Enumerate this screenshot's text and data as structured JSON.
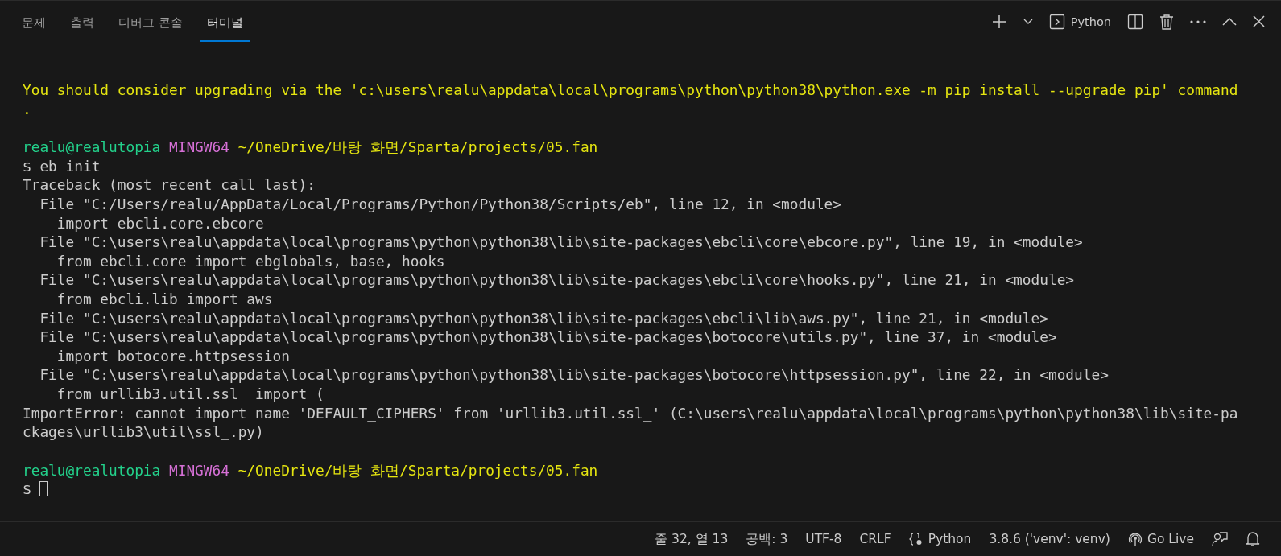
{
  "tabs": [
    {
      "label": "문제",
      "selected": false
    },
    {
      "label": "출력",
      "selected": false
    },
    {
      "label": "디버그 콘솔",
      "selected": false
    },
    {
      "label": "터미널",
      "selected": true
    }
  ],
  "toolbar": {
    "shell_label": "Python"
  },
  "terminal": {
    "blocks": [
      [
        {
          "segments": [
            {
              "kind": "warning",
              "text": "You should consider upgrading via the 'c:\\users\\realu\\appdata\\local\\programs\\python\\python38\\python.exe -m pip install --upgrade pip' command"
            }
          ]
        },
        {
          "segments": [
            {
              "kind": "warning",
              "text": "."
            }
          ]
        }
      ],
      [
        {
          "segments": [
            {
              "kind": "user",
              "text": "realu@realutopia"
            },
            {
              "kind": "host",
              "text": "MINGW64"
            },
            {
              "kind": "path",
              "text": "~/OneDrive/바탕 화면/Sparta/projects/05.fan"
            }
          ]
        },
        {
          "segments": [
            {
              "kind": "plain",
              "text": "$ eb init"
            }
          ]
        },
        {
          "segments": [
            {
              "kind": "plain",
              "text": "Traceback (most recent call last):"
            }
          ]
        },
        {
          "segments": [
            {
              "kind": "plain",
              "text": "  File \"C:/Users/realu/AppData/Local/Programs/Python/Python38/Scripts/eb\", line 12, in <module>"
            }
          ]
        },
        {
          "segments": [
            {
              "kind": "plain",
              "text": "    import ebcli.core.ebcore"
            }
          ]
        },
        {
          "segments": [
            {
              "kind": "plain",
              "text": "  File \"C:\\users\\realu\\appdata\\local\\programs\\python\\python38\\lib\\site-packages\\ebcli\\core\\ebcore.py\", line 19, in <module>"
            }
          ]
        },
        {
          "segments": [
            {
              "kind": "plain",
              "text": "    from ebcli.core import ebglobals, base, hooks"
            }
          ]
        },
        {
          "segments": [
            {
              "kind": "plain",
              "text": "  File \"C:\\users\\realu\\appdata\\local\\programs\\python\\python38\\lib\\site-packages\\ebcli\\core\\hooks.py\", line 21, in <module>"
            }
          ]
        },
        {
          "segments": [
            {
              "kind": "plain",
              "text": "    from ebcli.lib import aws"
            }
          ]
        },
        {
          "segments": [
            {
              "kind": "plain",
              "text": "  File \"C:\\users\\realu\\appdata\\local\\programs\\python\\python38\\lib\\site-packages\\ebcli\\lib\\aws.py\", line 21, in <module>"
            }
          ]
        },
        {
          "segments": [
            {
              "kind": "plain",
              "text": "  File \"C:\\users\\realu\\appdata\\local\\programs\\python\\python38\\lib\\site-packages\\botocore\\utils.py\", line 37, in <module>"
            }
          ]
        },
        {
          "segments": [
            {
              "kind": "plain",
              "text": "    import botocore.httpsession"
            }
          ]
        },
        {
          "segments": [
            {
              "kind": "plain",
              "text": "  File \"C:\\users\\realu\\appdata\\local\\programs\\python\\python38\\lib\\site-packages\\botocore\\httpsession.py\", line 22, in <module>"
            }
          ]
        },
        {
          "segments": [
            {
              "kind": "plain",
              "text": "    from urllib3.util.ssl_ import ("
            }
          ]
        },
        {
          "segments": [
            {
              "kind": "plain",
              "text": "ImportError: cannot import name 'DEFAULT_CIPHERS' from 'urllib3.util.ssl_' (C:\\users\\realu\\appdata\\local\\programs\\python\\python38\\lib\\site-pa"
            }
          ]
        },
        {
          "segments": [
            {
              "kind": "plain",
              "text": "ckages\\urllib3\\util\\ssl_.py)"
            }
          ]
        }
      ],
      [
        {
          "segments": [
            {
              "kind": "user",
              "text": "realu@realutopia"
            },
            {
              "kind": "host",
              "text": "MINGW64"
            },
            {
              "kind": "path",
              "text": "~/OneDrive/바탕 화면/Sparta/projects/05.fan"
            }
          ]
        },
        {
          "segments": [
            {
              "kind": "plain",
              "text": "$"
            }
          ],
          "cursor": true
        }
      ]
    ]
  },
  "status_bar": [
    {
      "kind": "text",
      "text": "줄 32, 열 13"
    },
    {
      "kind": "text",
      "text": "공백: 3"
    },
    {
      "kind": "text",
      "text": "UTF-8"
    },
    {
      "kind": "text",
      "text": "CRLF"
    },
    {
      "kind": "language",
      "text": "Python"
    },
    {
      "kind": "text",
      "text": "3.8.6 ('venv': venv)"
    },
    {
      "kind": "live",
      "text": "Go Live"
    },
    {
      "kind": "feedback"
    },
    {
      "kind": "bell"
    }
  ]
}
